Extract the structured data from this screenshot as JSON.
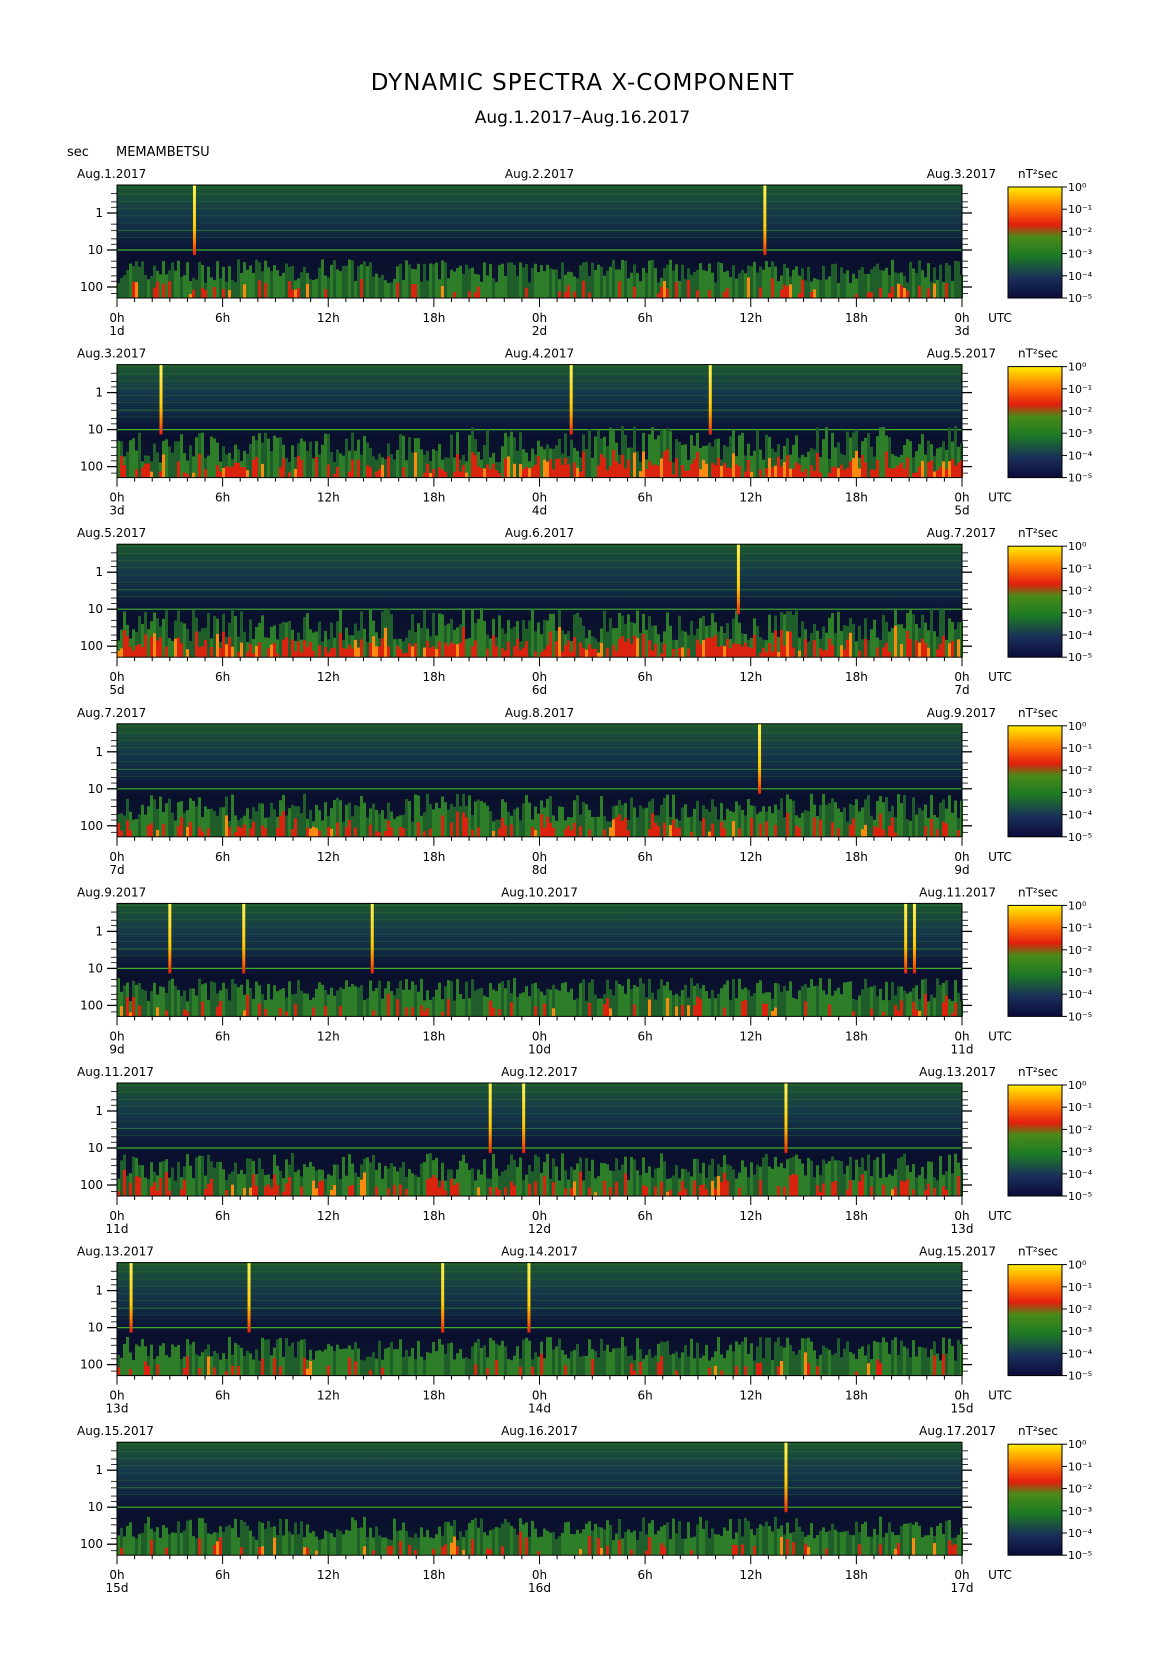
{
  "header": {
    "title": "DYNAMIC SPECTRA X-COMPONENT",
    "subtitle": "Aug.1.2017–Aug.16.2017",
    "unit": "sec",
    "station": "MEMAMBETSU"
  },
  "chart_data": {
    "type": "heatmap",
    "xlabel": "UTC",
    "ylabel": "sec",
    "y_ticks": [
      "1",
      "10",
      "100"
    ],
    "x_ticks": [
      "0h",
      "6h",
      "12h",
      "18h",
      "0h",
      "6h",
      "12h",
      "18h",
      "0h"
    ],
    "colorbar_label": "nT²sec",
    "colorbar_ticks": [
      "10⁰",
      "10⁻¹",
      "10⁻²",
      "10⁻³",
      "10⁻⁴",
      "10⁻⁵"
    ],
    "colors": {
      "scale": [
        "#0b0b3a",
        "#1a2f5a",
        "#1d7a24",
        "#5aa020",
        "#e31e0e",
        "#ff7a00",
        "#ffee00"
      ]
    },
    "panels": [
      {
        "date_left": "Aug.1.2017",
        "date_mid": "Aug.2.2017",
        "date_right": "Aug.3.2017",
        "day_left": "1d",
        "day_mid": "2d",
        "day_right": "3d",
        "spikes_hours": [
          4.4,
          36.8
        ],
        "activity": "low"
      },
      {
        "date_left": "Aug.3.2017",
        "date_mid": "Aug.4.2017",
        "date_right": "Aug.5.2017",
        "day_left": "3d",
        "day_mid": "4d",
        "day_right": "5d",
        "spikes_hours": [
          2.5,
          25.8,
          33.7
        ],
        "activity": "high-late"
      },
      {
        "date_left": "Aug.5.2017",
        "date_mid": "Aug.6.2017",
        "date_right": "Aug.7.2017",
        "day_left": "5d",
        "day_mid": "6d",
        "day_right": "7d",
        "spikes_hours": [
          35.3
        ],
        "activity": "high"
      },
      {
        "date_left": "Aug.7.2017",
        "date_mid": "Aug.8.2017",
        "date_right": "Aug.9.2017",
        "day_left": "7d",
        "day_mid": "8d",
        "day_right": "9d",
        "spikes_hours": [
          36.5
        ],
        "activity": "mid"
      },
      {
        "date_left": "Aug.9.2017",
        "date_mid": "Aug.10.2017",
        "date_right": "Aug.11.2017",
        "day_left": "9d",
        "day_mid": "10d",
        "day_right": "11d",
        "spikes_hours": [
          3.0,
          7.2,
          14.5,
          44.8,
          45.3
        ],
        "activity": "low"
      },
      {
        "date_left": "Aug.11.2017",
        "date_mid": "Aug.12.2017",
        "date_right": "Aug.13.2017",
        "day_left": "11d",
        "day_mid": "12d",
        "day_right": "13d",
        "spikes_hours": [
          21.2,
          23.1,
          38.0
        ],
        "activity": "mid"
      },
      {
        "date_left": "Aug.13.2017",
        "date_mid": "Aug.14.2017",
        "date_right": "Aug.15.2017",
        "day_left": "13d",
        "day_mid": "14d",
        "day_right": "15d",
        "spikes_hours": [
          0.8,
          7.5,
          18.5,
          23.4
        ],
        "activity": "low"
      },
      {
        "date_left": "Aug.15.2017",
        "date_mid": "Aug.16.2017",
        "date_right": "Aug.17.2017",
        "day_left": "15d",
        "day_mid": "16d",
        "day_right": "17d",
        "spikes_hours": [
          38.0
        ],
        "activity": "low"
      }
    ]
  }
}
